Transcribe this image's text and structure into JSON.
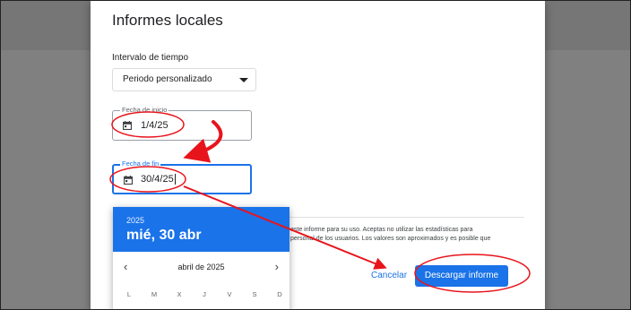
{
  "dialog": {
    "title": "Informes locales",
    "interval_label": "Intervalo de tiempo",
    "interval_value": "Periodo personalizado",
    "start_label": "Fecha de inicio",
    "start_value": "1/4/25",
    "end_label": "Fecha de fin",
    "end_value": "30/4/25",
    "body_line1": "este informe para su uso. Aceptas no utilizar las estadísticas para",
    "body_line2": "personal de los usuarios. Los valores son aproximados y es posible que",
    "cancel_label": "Cancelar",
    "download_label": "Descargar informe"
  },
  "calendar": {
    "year": "2025",
    "selected_date": "mié, 30 abr",
    "month_label": "abril de 2025",
    "weekdays": [
      "L",
      "M",
      "X",
      "J",
      "V",
      "S",
      "D"
    ]
  },
  "icons": {
    "calendar": "calendar-icon",
    "dropdown": "caret-down-icon",
    "prev": "chevron-left-icon",
    "next": "chevron-right-icon"
  },
  "annotation_color": "#e8141c",
  "accent": "#1a73e8"
}
